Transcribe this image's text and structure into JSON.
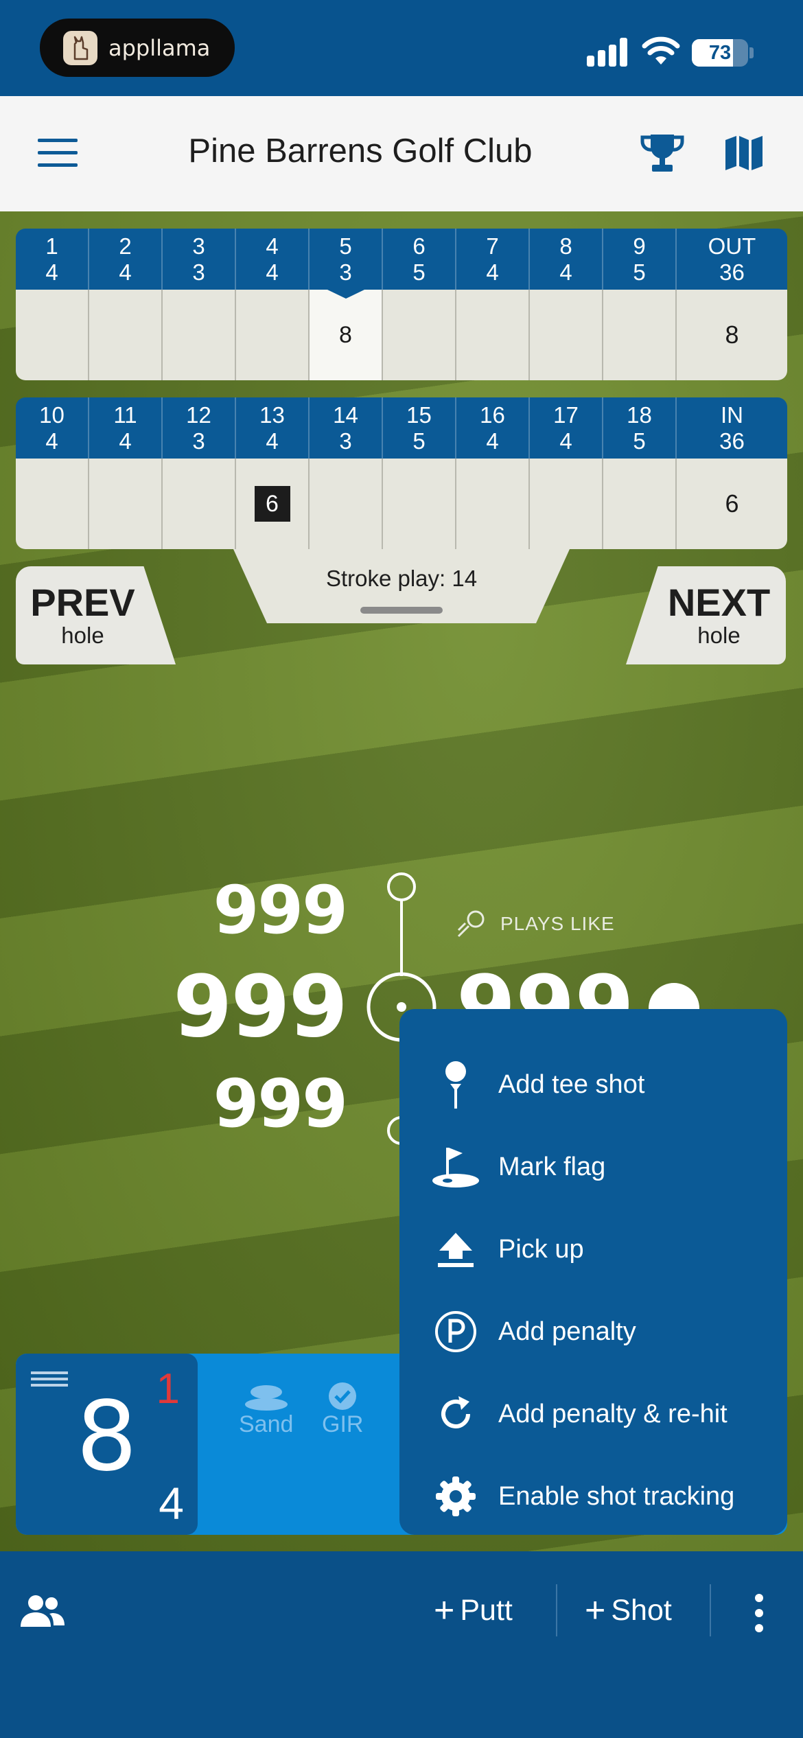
{
  "status_bar": {
    "app_name": "appllama",
    "battery": "73",
    "battery_level": 0.73
  },
  "header": {
    "title": "Pine Barrens Golf Club"
  },
  "scorecard": {
    "front": {
      "holes": [
        {
          "hole": "1",
          "par": "4",
          "score": ""
        },
        {
          "hole": "2",
          "par": "4",
          "score": ""
        },
        {
          "hole": "3",
          "par": "3",
          "score": ""
        },
        {
          "hole": "4",
          "par": "4",
          "score": ""
        },
        {
          "hole": "5",
          "par": "3",
          "score": "8"
        },
        {
          "hole": "6",
          "par": "5",
          "score": ""
        },
        {
          "hole": "7",
          "par": "4",
          "score": ""
        },
        {
          "hole": "8",
          "par": "4",
          "score": ""
        },
        {
          "hole": "9",
          "par": "5",
          "score": ""
        }
      ],
      "total_label": "OUT",
      "total_par": "36",
      "total_score": "8"
    },
    "back": {
      "holes": [
        {
          "hole": "10",
          "par": "4",
          "score": ""
        },
        {
          "hole": "11",
          "par": "4",
          "score": ""
        },
        {
          "hole": "12",
          "par": "3",
          "score": ""
        },
        {
          "hole": "13",
          "par": "4",
          "score": "6"
        },
        {
          "hole": "14",
          "par": "3",
          "score": ""
        },
        {
          "hole": "15",
          "par": "5",
          "score": ""
        },
        {
          "hole": "16",
          "par": "4",
          "score": ""
        },
        {
          "hole": "17",
          "par": "4",
          "score": ""
        },
        {
          "hole": "18",
          "par": "5",
          "score": ""
        }
      ],
      "total_label": "IN",
      "total_par": "36",
      "total_score": "6"
    },
    "stroke_play": "Stroke play: 14"
  },
  "nav": {
    "prev_big": "PREV",
    "prev_small": "hole",
    "next_big": "NEXT",
    "next_small": "hole"
  },
  "distances": {
    "back": "999",
    "middle": "999",
    "front": "999",
    "plays_like_label": "PLAYS LIKE",
    "plays_like_value": "999"
  },
  "score_panel": {
    "over_par": "1",
    "strokes": "8",
    "par": "4",
    "sand_label": "Sand",
    "gir_label": "GIR"
  },
  "menu": {
    "items": [
      {
        "label": "Add tee shot",
        "icon": "tee-icon"
      },
      {
        "label": "Mark flag",
        "icon": "flag-icon"
      },
      {
        "label": "Pick up",
        "icon": "pick-up-icon"
      },
      {
        "label": "Add penalty",
        "icon": "penalty-icon"
      },
      {
        "label": "Add penalty & re-hit",
        "icon": "rehit-icon"
      },
      {
        "label": "Enable shot tracking",
        "icon": "gear-icon"
      }
    ]
  },
  "bottom_bar": {
    "putt_label": "Putt",
    "shot_label": "Shot"
  }
}
